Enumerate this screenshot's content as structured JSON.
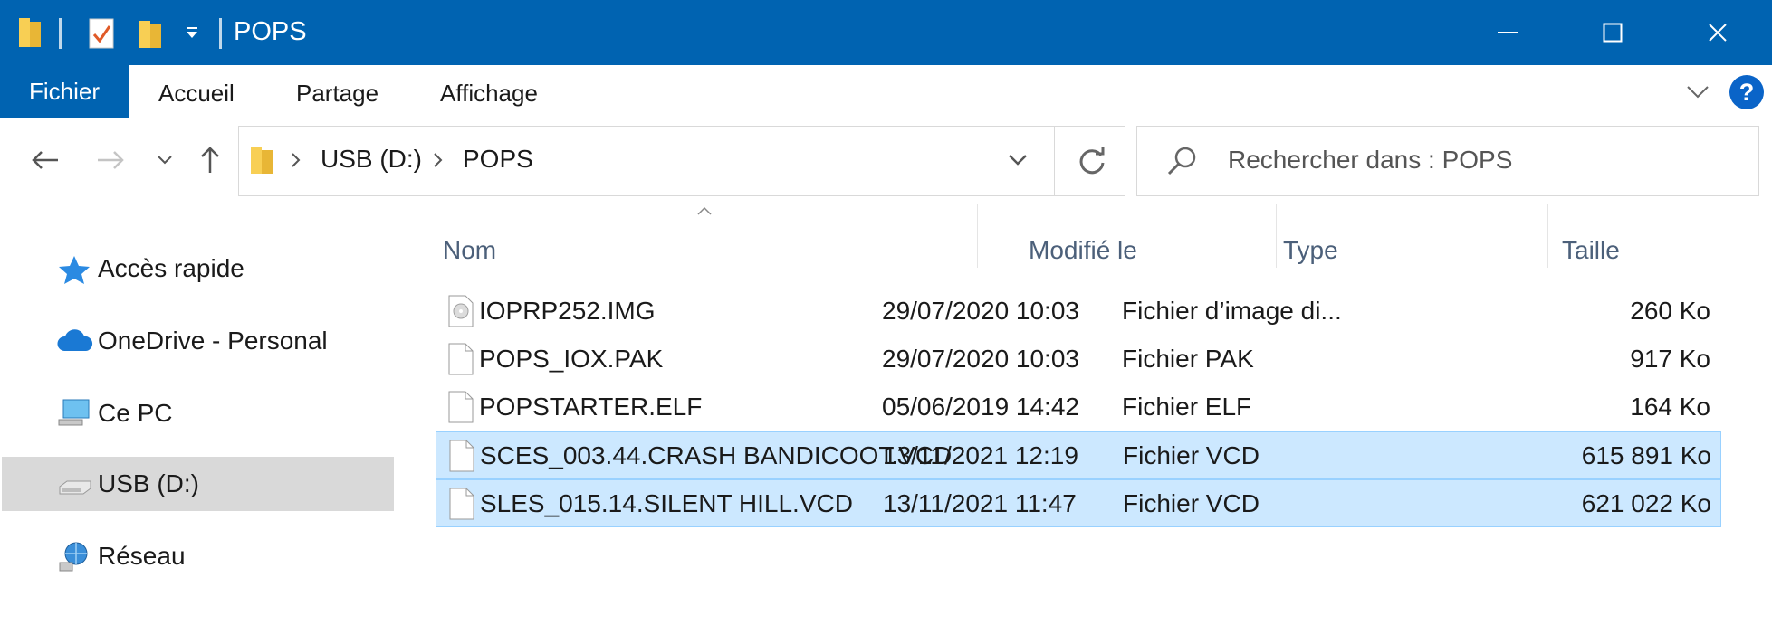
{
  "window": {
    "title": "POPS",
    "controls": {
      "minimize": "minimize",
      "maximize": "maximize",
      "close": "close"
    }
  },
  "ribbon": {
    "file_tab": "Fichier",
    "tabs": [
      "Accueil",
      "Partage",
      "Affichage"
    ],
    "help": "?"
  },
  "address": {
    "crumbs": [
      "USB (D:)",
      "POPS"
    ]
  },
  "search": {
    "placeholder": "Rechercher dans : POPS"
  },
  "sidebar": {
    "items": [
      {
        "label": "Accès rapide",
        "icon": "star-icon"
      },
      {
        "label": "OneDrive - Personal",
        "icon": "cloud-icon"
      },
      {
        "label": "Ce PC",
        "icon": "computer-icon"
      },
      {
        "label": "USB (D:)",
        "icon": "usb-drive-icon",
        "selected": true
      },
      {
        "label": "Réseau",
        "icon": "network-icon"
      }
    ]
  },
  "columns": {
    "name": "Nom",
    "modified": "Modifié le",
    "type": "Type",
    "size": "Taille"
  },
  "files": [
    {
      "name": "IOPRP252.IMG",
      "modified": "29/07/2020 10:03",
      "type": "Fichier d’image di...",
      "size": "260 Ko",
      "icon": "disc-image-icon",
      "selected": false
    },
    {
      "name": "POPS_IOX.PAK",
      "modified": "29/07/2020 10:03",
      "type": "Fichier PAK",
      "size": "917 Ko",
      "icon": "file-icon",
      "selected": false
    },
    {
      "name": "POPSTARTER.ELF",
      "modified": "05/06/2019 14:42",
      "type": "Fichier ELF",
      "size": "164 Ko",
      "icon": "file-icon",
      "selected": false
    },
    {
      "name": "SCES_003.44.CRASH BANDICOOT.VCD",
      "modified": "13/11/2021 12:19",
      "type": "Fichier VCD",
      "size": "615 891 Ko",
      "icon": "file-icon",
      "selected": true
    },
    {
      "name": "SLES_015.14.SILENT HILL.VCD",
      "modified": "13/11/2021 11:47",
      "type": "Fichier VCD",
      "size": "621 022 Ko",
      "icon": "file-icon",
      "selected": true
    }
  ],
  "colors": {
    "titlebar": "#0063b1",
    "selection": "#cce8ff",
    "selection_border": "#99d1ff",
    "sidebar_selected": "#d9d9d9"
  }
}
